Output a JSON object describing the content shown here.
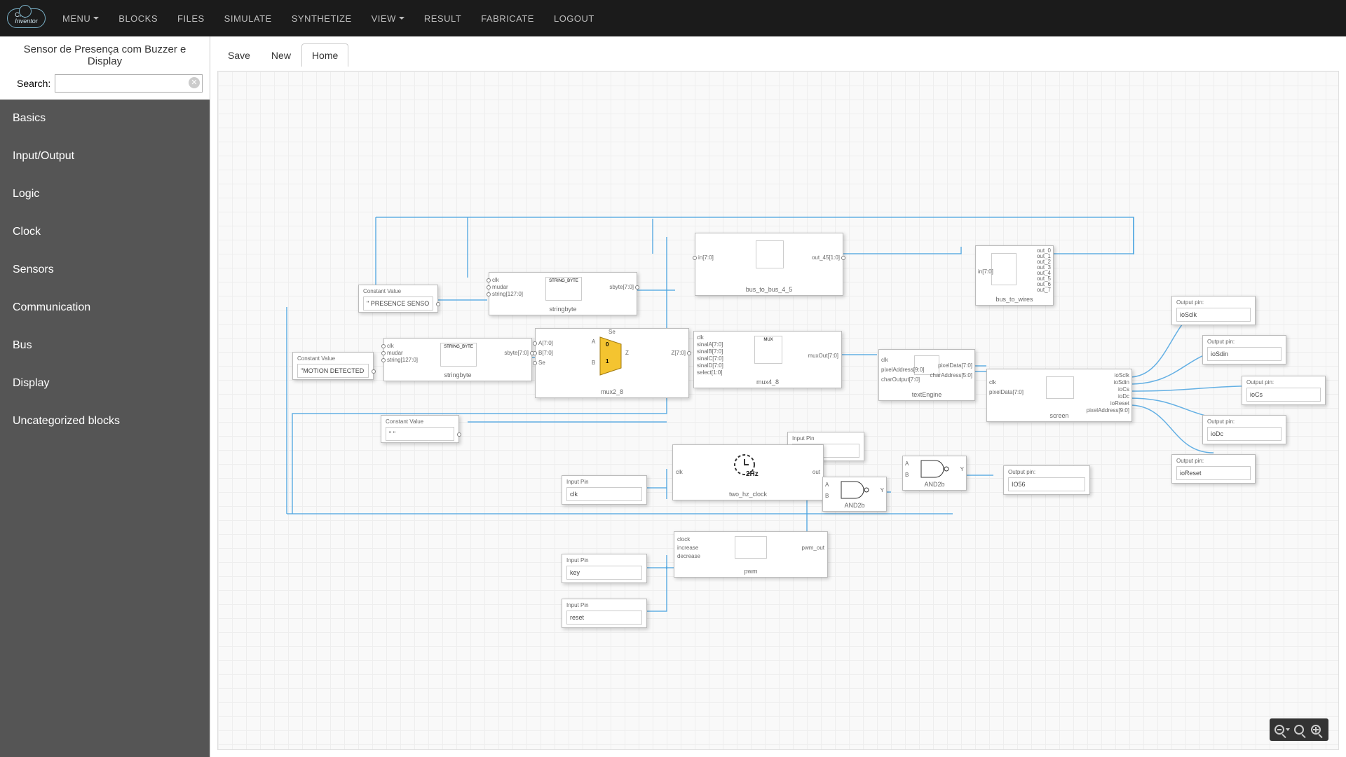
{
  "logo": {
    "top": "Chip",
    "bottom": "Inventor"
  },
  "nav": {
    "menu": "MENU",
    "blocks": "BLOCKS",
    "files": "FILES",
    "simulate": "SIMULATE",
    "synthetize": "SYNTHETIZE",
    "view": "VIEW",
    "result": "RESULT",
    "fabricate": "FABRICATE",
    "logout": "LOGOUT"
  },
  "sidebar": {
    "project_title": "Sensor de Presença com Buzzer e Display",
    "search_label": "Search:",
    "search_value": "",
    "categories": [
      "Basics",
      "Input/Output",
      "Logic",
      "Clock",
      "Sensors",
      "Communication",
      "Bus",
      "Display",
      "Uncategorized blocks"
    ]
  },
  "tabs": {
    "save": "Save",
    "new": "New",
    "home": "Home"
  },
  "blocks": {
    "const1": {
      "header": "Constant Value",
      "value": "\" PRESENCE SENSO"
    },
    "const2": {
      "header": "Constant Value",
      "value": "\"MOTION DETECTED"
    },
    "const3": {
      "header": "Constant Value",
      "value": "\" \""
    },
    "stringbyte1": {
      "title": "stringbyte",
      "thumb": "STRING_BYTE",
      "ports_left": [
        "clk",
        "mudar",
        "string[127:0]"
      ],
      "ports_right": [
        "sbyte[7:0]"
      ]
    },
    "stringbyte2": {
      "title": "stringbyte",
      "thumb": "STRING_BYTE",
      "ports_left": [
        "clk",
        "mudar",
        "string[127:0]"
      ],
      "ports_right": [
        "sbyte[7:0]"
      ]
    },
    "mux2_8": {
      "title": "mux2_8",
      "ports_left": [
        "A[7:0]",
        "B[7:0]",
        "Se"
      ],
      "ports_right": [
        "Z[7:0]"
      ],
      "inner": {
        "A": "A",
        "B": "B",
        "Se": "Se",
        "Z": "Z",
        "zero": "0",
        "one": "1"
      }
    },
    "mux4_8": {
      "title": "mux4_8",
      "thumb": "MUX",
      "ports_left": [
        "clk",
        "sinalA[7:0]",
        "sinalB[7:0]",
        "sinalC[7:0]",
        "sinalD[7:0]",
        "select[1:0]"
      ],
      "ports_right": [
        "muxOut[7:0]"
      ]
    },
    "bus_to_bus": {
      "title": "bus_to_bus_4_5",
      "ports_left": [
        "in[7:0]"
      ],
      "ports_right": [
        "out_45[1:0]"
      ]
    },
    "bus_to_wires": {
      "title": "bus_to_wires",
      "ports_left": [
        "in[7:0]"
      ],
      "ports_right": [
        "out_0",
        "out_1",
        "out_2",
        "out_3",
        "out_4",
        "out_5",
        "out_6",
        "out_7"
      ]
    },
    "textengine": {
      "title": "textEngine",
      "ports_left": [
        "clk",
        "pixelAddress[9:0]",
        "charOutput[7:0]"
      ],
      "ports_right": [
        "pixelData[7:0]",
        "charAddress[5:0]"
      ]
    },
    "screen": {
      "title": "screen",
      "ports_left": [
        "clk",
        "pixelData[7:0]"
      ],
      "ports_right": [
        "ioSclk",
        "ioSdin",
        "ioCs",
        "ioDc",
        "ioReset",
        "pixelAddress[9:0]"
      ]
    },
    "two_hz": {
      "title": "two_hz_clock",
      "ports_left": [
        "clk"
      ],
      "ports_right": [
        "out"
      ],
      "badge": "2Hz"
    },
    "and2b_1": {
      "title": "AND2b",
      "ports_left": [
        "A",
        "B"
      ],
      "ports_right": [
        "Y"
      ]
    },
    "and2b_2": {
      "title": "AND2b",
      "ports_left": [
        "A",
        "B"
      ],
      "ports_right": [
        "Y"
      ]
    },
    "pwm": {
      "title": "pwm",
      "ports_left": [
        "clock",
        "increase",
        "decrease"
      ],
      "ports_right": [
        "pwm_out"
      ]
    },
    "inpin1": {
      "header": "Input Pin",
      "value": ""
    },
    "inpin_clk": {
      "header": "Input Pin",
      "value": "clk"
    },
    "inpin_key": {
      "header": "Input Pin",
      "value": "key"
    },
    "inpin_reset": {
      "header": "Input Pin",
      "value": "reset"
    },
    "outpin1": {
      "header": "Output pin:",
      "value": "ioSclk"
    },
    "outpin2": {
      "header": "Output pin:",
      "value": "ioSdin"
    },
    "outpin3": {
      "header": "Output pin:",
      "value": "ioCs"
    },
    "outpin4": {
      "header": "Output pin:",
      "value": "ioDc"
    },
    "outpin5": {
      "header": "Output pin:",
      "value": "ioReset"
    },
    "outpin6": {
      "header": "Output pin:",
      "value": "IO56"
    }
  },
  "zoom": {
    "out": "zoom-out",
    "fit": "zoom-fit",
    "in": "zoom-in"
  }
}
